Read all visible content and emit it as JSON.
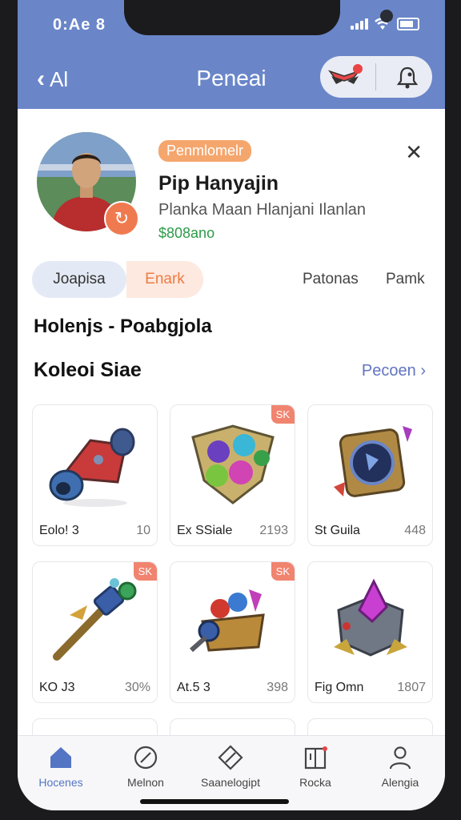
{
  "status_bar": {
    "time": "0:Ae 8"
  },
  "header": {
    "back_label": "Al",
    "title": "Peneai"
  },
  "profile": {
    "tag": "Penmlomelr",
    "name": "Pip Hanyajin",
    "subtitle": "Planka Maan Hlanjani Ilanlan",
    "value": "$808ano"
  },
  "tabs": [
    "Joapisa",
    "Enark",
    "Patonas",
    "Pamk"
  ],
  "headline": "Holenjs - Poabgjola",
  "section": {
    "title": "Koleoi Siae",
    "link": "Pecoen"
  },
  "items": [
    {
      "name": "Eolo! 3",
      "value": "10",
      "badge": ""
    },
    {
      "name": "Ex SSiale",
      "value": "2193",
      "badge": "SK"
    },
    {
      "name": "St Guila",
      "value": "448",
      "badge": ""
    },
    {
      "name": "KO J3",
      "value": "30%",
      "badge": "SK"
    },
    {
      "name": "At.5 3",
      "value": "398",
      "badge": "SK"
    },
    {
      "name": "Fig Omn",
      "value": "1807",
      "badge": ""
    }
  ],
  "tabbar": [
    "Hocenes",
    "Melnon",
    "Saanelogipt",
    "Rocka",
    "Alengia"
  ],
  "colors": {
    "header": "#6a86c9",
    "accent": "#f07a4f",
    "link": "#6274c0",
    "active_tab": "#5474c4"
  }
}
